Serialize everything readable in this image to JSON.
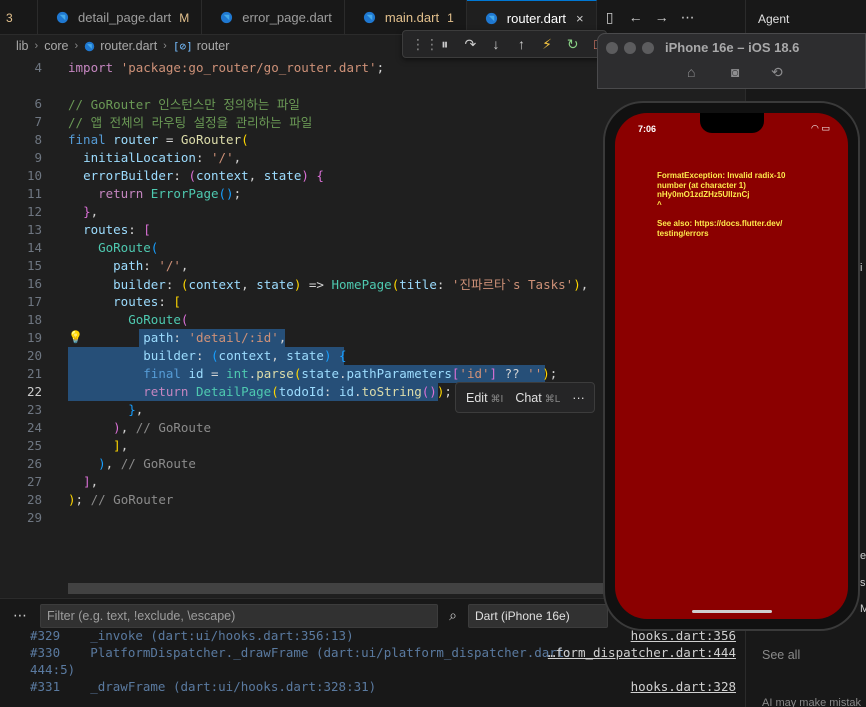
{
  "tabs": {
    "index_label": "3",
    "items": [
      {
        "label": "detail_page.dart",
        "mark": "M"
      },
      {
        "label": "error_page.dart",
        "mark": ""
      },
      {
        "label": "main.dart",
        "mark": "1"
      },
      {
        "label": "router.dart",
        "mark": "×"
      }
    ]
  },
  "breadcrumb": {
    "parts": [
      "lib",
      "core",
      "router.dart",
      "router"
    ]
  },
  "editor": {
    "lines": [
      "4",
      "6",
      "7",
      "8",
      "9",
      "10",
      "11",
      "12",
      "13",
      "14",
      "15",
      "16",
      "17",
      "18",
      "19",
      "20",
      "21",
      "22",
      "23",
      "24",
      "25",
      "26",
      "27",
      "28",
      "29"
    ],
    "current_line": "22",
    "code": {
      "import_kw": "import",
      "import_path": "'package:go_router/go_router.dart'",
      "comment1": "// GoRouter 인스턴스만 정의하는 파일",
      "comment2": "// 앱 전체의 라우팅 설정을 관리하는 파일",
      "final_kw": "final",
      "router_name": "router",
      "gorouter": "GoRouter",
      "initial_location_key": "initialLocation",
      "initial_location_val": "'/'",
      "error_builder_key": "errorBuilder",
      "context": "context",
      "state": "state",
      "return_kw": "return",
      "error_page": "ErrorPage",
      "routes_key": "routes",
      "goroute": "GoRoute",
      "path_key": "path",
      "path_root": "'/'",
      "builder_key": "builder",
      "home_page": "HomePage",
      "title_key": "title",
      "title_val": "'진파르타`s Tasks'",
      "detail_path": "'detail/:id'",
      "id_var": "id",
      "int_type": "int",
      "parse_fn": "parse",
      "path_params": "pathParameters",
      "id_key": "'id'",
      "empty_str": "''",
      "detail_page": "DetailPage",
      "todo_id_key": "todoId",
      "to_string": "toString",
      "hint_goroute": "// GoRoute",
      "hint_gorouter": "// GoRouter"
    }
  },
  "inline_chat": {
    "edit": "Edit",
    "edit_key": "⌘I",
    "chat": "Chat",
    "chat_key": "⌘L",
    "more": "···"
  },
  "panel": {
    "filter_placeholder": "Filter (e.g. text, !exclude, \\escape)",
    "device": "Dart (iPhone 16e)",
    "lines": [
      {
        "text": "#329    _invoke (dart:ui/hooks.dart:356:13)",
        "link": "hooks.dart:356"
      },
      {
        "text": "#330    PlatformDispatcher._drawFrame (dart:ui/platform_dispatcher.dart:",
        "link": "…form_dispatcher.dart:444"
      },
      {
        "text": "444:5)",
        "link": ""
      },
      {
        "text": "#331    _drawFrame (dart:ui/hooks.dart:328:31)",
        "link": "hooks.dart:328"
      }
    ]
  },
  "agent": {
    "title": "Agent",
    "see_all": "See all",
    "note": "AI may make mistak"
  },
  "simulator": {
    "title": "iPhone 16e – iOS 18.6",
    "status_time": "7:06",
    "error_lines": [
      "FormatException: Invalid radix-10",
      "number (at character 1)",
      "nHy0mO1zdZHz5UIlznCj",
      "^"
    ],
    "see_also": [
      "See also: https://docs.flutter.dev/",
      "testing/errors"
    ],
    "screen_color": "#8b0000",
    "text_color": "#ffea4c"
  }
}
